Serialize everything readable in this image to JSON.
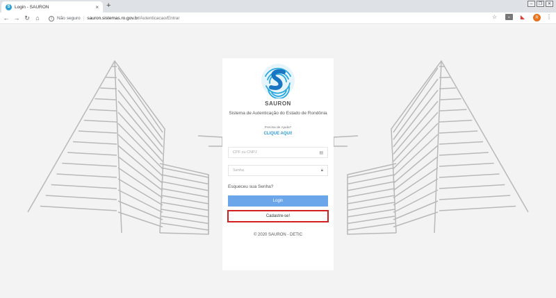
{
  "browser": {
    "tab_title": "Login - SAURON",
    "tab_favicon_letter": "S",
    "tab_close": "×",
    "new_tab": "+",
    "insecure_label": "Não seguro",
    "url_host": "sauron.sistemas.ro.gov.br",
    "url_path": "/Autenticacao/Entrar",
    "avatar_letter": "R"
  },
  "login": {
    "brand": "SAURON",
    "subtitle": "Sistema de Autenticação do Estado de Rondônia",
    "help_question": "Precisa de Ajuda?",
    "help_link": "CLIQUE AQUI!",
    "cpf_placeholder": "CPF ou CNPJ",
    "password_placeholder": "Senha",
    "forgot_label": "Esqueceu sua Senha?",
    "login_button": "Login",
    "register_button": "Cadastre-se!",
    "footer": "©  2020  SAURON -  DETIC"
  },
  "colors": {
    "accent_blue": "#6ba6ea",
    "link_blue": "#2f9ad8",
    "highlight_red": "#d31e1e",
    "logo_blue": "#29a8e0"
  }
}
